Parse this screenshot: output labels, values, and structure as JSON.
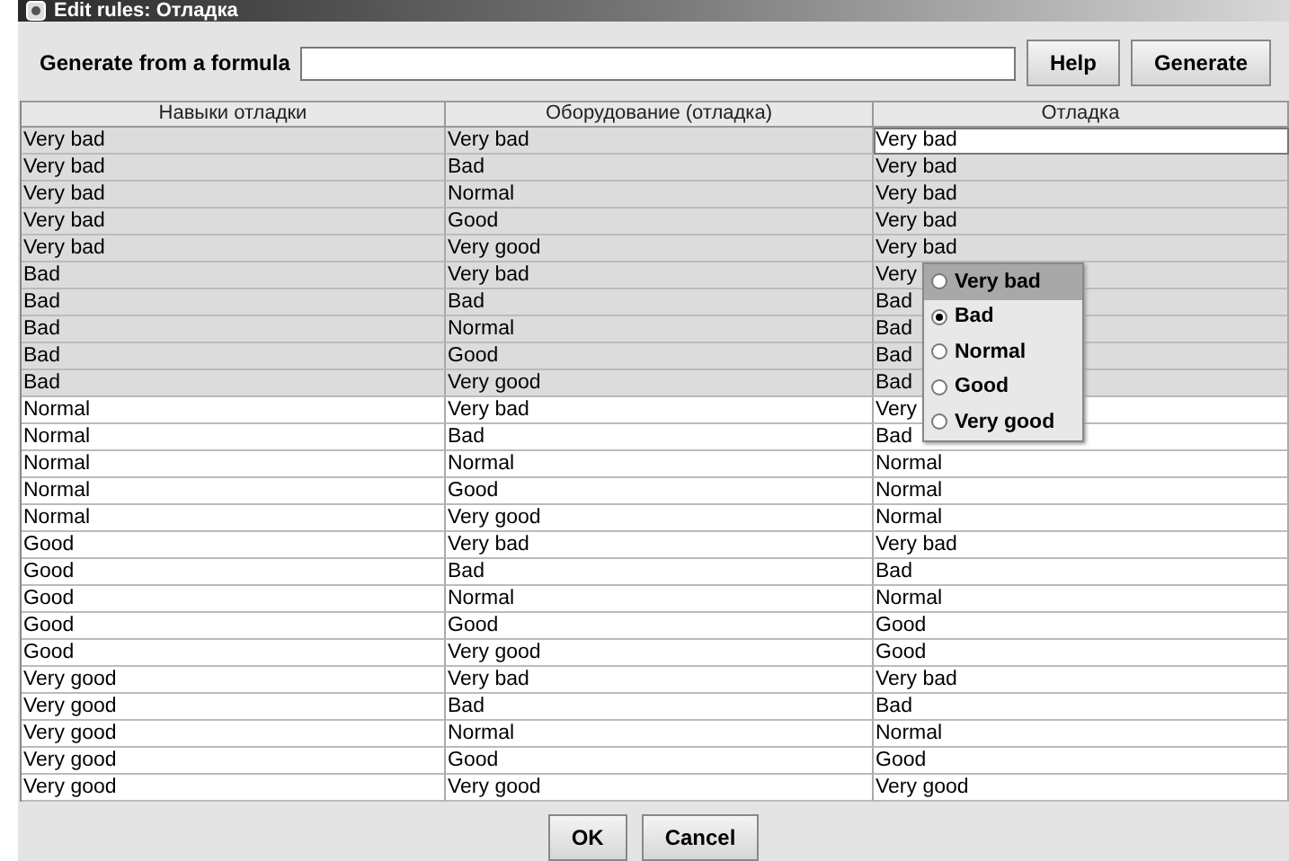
{
  "window": {
    "title": "Edit rules: Отладка"
  },
  "formula": {
    "label": "Generate from a formula"
  },
  "buttons_top": [
    "Help",
    "Generate"
  ],
  "table": {
    "columns": [
      "Навыки отладки",
      "Оборудование (отладка)",
      "Отладка"
    ],
    "rows": [
      {
        "cells": [
          "Very bad",
          "Very bad",
          "Very bad"
        ],
        "selected": true,
        "editing": true
      },
      {
        "cells": [
          "Very bad",
          "Bad",
          "Very bad"
        ],
        "selected": true,
        "editing": false
      },
      {
        "cells": [
          "Very bad",
          "Normal",
          "Very bad"
        ],
        "selected": true,
        "editing": false
      },
      {
        "cells": [
          "Very bad",
          "Good",
          "Very bad"
        ],
        "selected": true,
        "editing": false
      },
      {
        "cells": [
          "Very bad",
          "Very good",
          "Very bad"
        ],
        "selected": true,
        "editing": false
      },
      {
        "cells": [
          "Bad",
          "Very bad",
          "Very"
        ],
        "selected": true,
        "editing": false
      },
      {
        "cells": [
          "Bad",
          "Bad",
          "Bad"
        ],
        "selected": true,
        "editing": false
      },
      {
        "cells": [
          "Bad",
          "Normal",
          "Bad"
        ],
        "selected": true,
        "editing": false
      },
      {
        "cells": [
          "Bad",
          "Good",
          "Bad"
        ],
        "selected": true,
        "editing": false
      },
      {
        "cells": [
          "Bad",
          "Very good",
          "Bad"
        ],
        "selected": true,
        "editing": false
      },
      {
        "cells": [
          "Normal",
          "Very bad",
          "Very"
        ],
        "selected": false,
        "editing": false
      },
      {
        "cells": [
          "Normal",
          "Bad",
          "Bad"
        ],
        "selected": false,
        "editing": false
      },
      {
        "cells": [
          "Normal",
          "Normal",
          "Normal"
        ],
        "selected": false,
        "editing": false
      },
      {
        "cells": [
          "Normal",
          "Good",
          "Normal"
        ],
        "selected": false,
        "editing": false
      },
      {
        "cells": [
          "Normal",
          "Very good",
          "Normal"
        ],
        "selected": false,
        "editing": false
      },
      {
        "cells": [
          "Good",
          "Very bad",
          "Very bad"
        ],
        "selected": false,
        "editing": false
      },
      {
        "cells": [
          "Good",
          "Bad",
          "Bad"
        ],
        "selected": false,
        "editing": false
      },
      {
        "cells": [
          "Good",
          "Normal",
          "Normal"
        ],
        "selected": false,
        "editing": false
      },
      {
        "cells": [
          "Good",
          "Good",
          "Good"
        ],
        "selected": false,
        "editing": false
      },
      {
        "cells": [
          "Good",
          "Very good",
          "Good"
        ],
        "selected": false,
        "editing": false
      },
      {
        "cells": [
          "Very good",
          "Very bad",
          "Very bad"
        ],
        "selected": false,
        "editing": false
      },
      {
        "cells": [
          "Very good",
          "Bad",
          "Bad"
        ],
        "selected": false,
        "editing": false
      },
      {
        "cells": [
          "Very good",
          "Normal",
          "Normal"
        ],
        "selected": false,
        "editing": false
      },
      {
        "cells": [
          "Very good",
          "Good",
          "Good"
        ],
        "selected": false,
        "editing": false
      },
      {
        "cells": [
          "Very good",
          "Very good",
          "Very good"
        ],
        "selected": false,
        "editing": false
      }
    ]
  },
  "popup": {
    "options": [
      {
        "label": "Very bad",
        "checked": false,
        "highlighted": true
      },
      {
        "label": "Bad",
        "checked": true,
        "highlighted": false
      },
      {
        "label": "Normal",
        "checked": false,
        "highlighted": false
      },
      {
        "label": "Good",
        "checked": false,
        "highlighted": false
      },
      {
        "label": "Very good",
        "checked": false,
        "highlighted": false
      }
    ]
  },
  "buttons_bottom": [
    "OK",
    "Cancel"
  ]
}
